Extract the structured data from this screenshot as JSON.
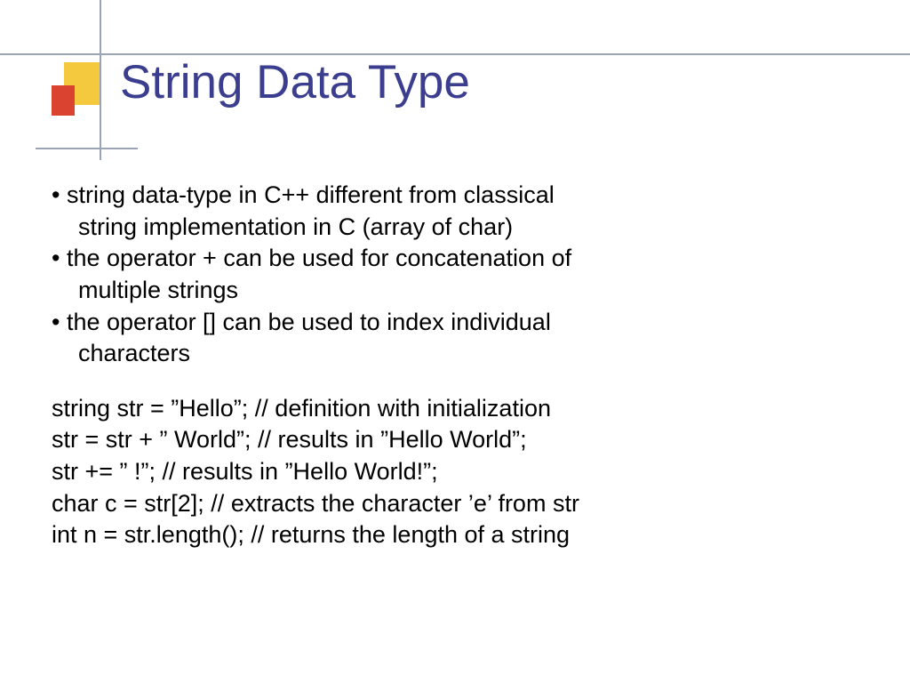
{
  "title": "String Data Type",
  "bullets": {
    "b1a": "• string data-type in C++ different from classical",
    "b1b": "string implementation in C (array of char)",
    "b2a": "• the operator + can be used for concatenation of",
    "b2b": "multiple strings",
    "b3a": "• the operator [] can be used to index individual",
    "b3b": "characters"
  },
  "code": {
    "l1": "string str = ”Hello”;    // definition with initialization",
    "l2": "str = str + ” World”;   // results in ”Hello World”;",
    "l3": "str += ” !”;                 // results in ”Hello World!”;",
    "l4": "char c = str[2];         // extracts the character ’e’ from str",
    "l5": "int n = str.length();   // returns the length of a string"
  }
}
